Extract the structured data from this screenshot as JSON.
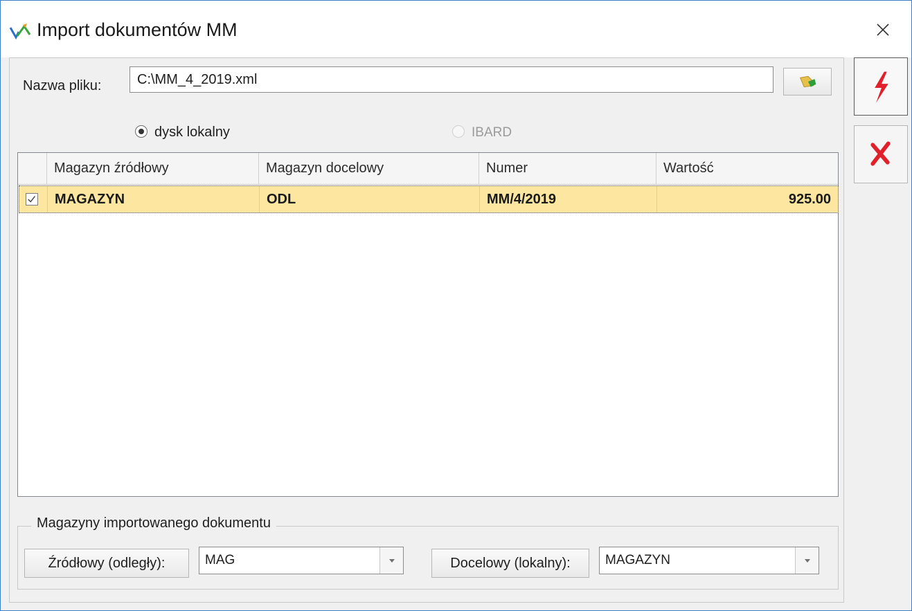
{
  "window": {
    "title": "Import dokumentów MM",
    "icon": "import-icon",
    "close_icon": "close-icon"
  },
  "file": {
    "label": "Nazwa pliku:",
    "value": "C:\\MM_4_2019.xml",
    "browse_icon": "folder-open-icon"
  },
  "source": {
    "options": [
      {
        "label": "dysk lokalny",
        "checked": true,
        "enabled": true
      },
      {
        "label": "IBARD",
        "checked": false,
        "enabled": false
      }
    ]
  },
  "grid": {
    "columns": [
      "Magazyn źródłowy",
      "Magazyn docelowy",
      "Numer",
      "Wartość"
    ],
    "rows": [
      {
        "checked": true,
        "source": "MAGAZYN",
        "target": "ODL",
        "number": "MM/4/2019",
        "value": "925.00"
      }
    ],
    "selected_row_color": "#fde6a0"
  },
  "warehouses": {
    "legend": "Magazyny importowanego dokumentu",
    "source_label": "Źródłowy (odległy):",
    "source_value": "MAG",
    "target_label": "Docelowy (lokalny):",
    "target_value": "MAGAZYN"
  },
  "actions": {
    "run_icon": "lightning-icon",
    "cancel_icon": "cancel-x-icon",
    "accent_color": "#e0202a"
  }
}
